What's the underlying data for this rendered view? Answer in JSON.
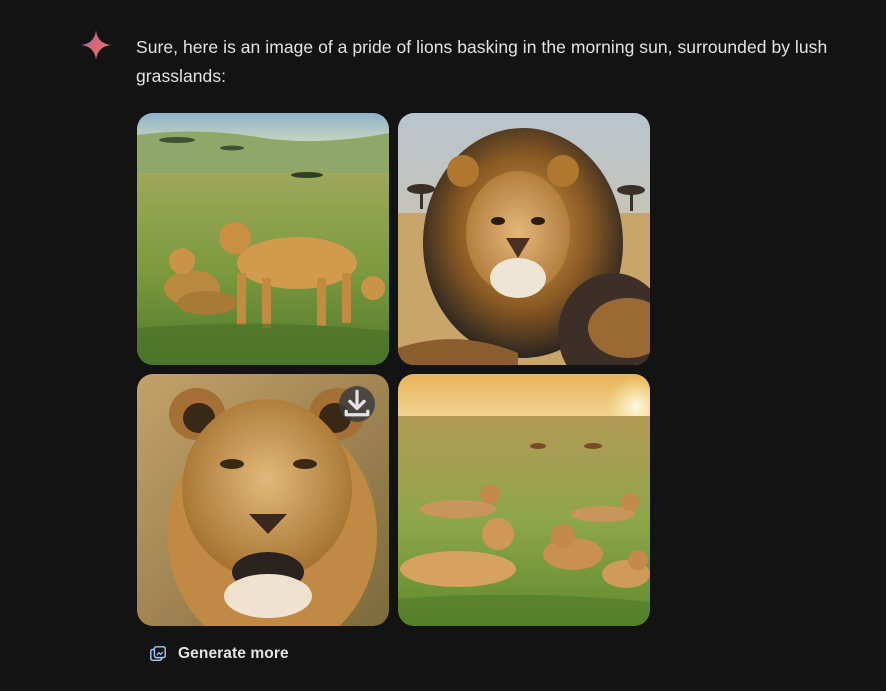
{
  "response": {
    "text": "Sure, here is an image of a pride of lions basking in the morning sun, surrounded by lush grasslands:"
  },
  "images": [
    {
      "icon": "lion-pride-grassland-image"
    },
    {
      "icon": "male-lion-portrait-image"
    },
    {
      "icon": "lioness-portrait-image"
    },
    {
      "icon": "lions-resting-sunrise-image"
    }
  ],
  "actions": {
    "download_icon": "download-icon",
    "generate_more_label": "Generate more"
  },
  "colors": {
    "background": "#131314",
    "text": "#e3e3e3",
    "accent_sparkle": "#d96570",
    "generate_icon": "#a8c7fa"
  }
}
